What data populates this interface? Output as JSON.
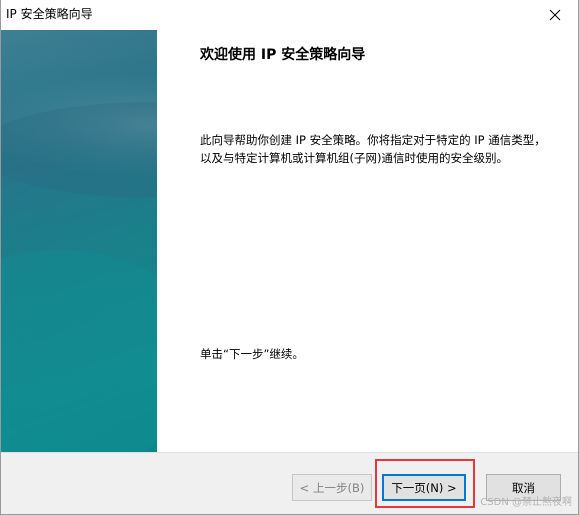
{
  "window": {
    "title": "IP 安全策略向导"
  },
  "content": {
    "heading": "欢迎使用 IP 安全策略向导",
    "description": "此向导帮助你创建 IP 安全策略。你将指定对于特定的 IP 通信类型，以及与特定计算机或计算机组(子网)通信时使用的安全级别。",
    "hint": "单击“下一步”继续。"
  },
  "buttons": {
    "back_label": "< 上一步(B)",
    "next_label": "下一页(N) >",
    "cancel_label": "取消"
  },
  "watermark": "CSDN @禁止熬夜啊",
  "colors": {
    "accent": "#0078d7",
    "highlight": "#e4393c",
    "banner": "#1b7c86"
  },
  "icons": {
    "close": "close-icon"
  }
}
